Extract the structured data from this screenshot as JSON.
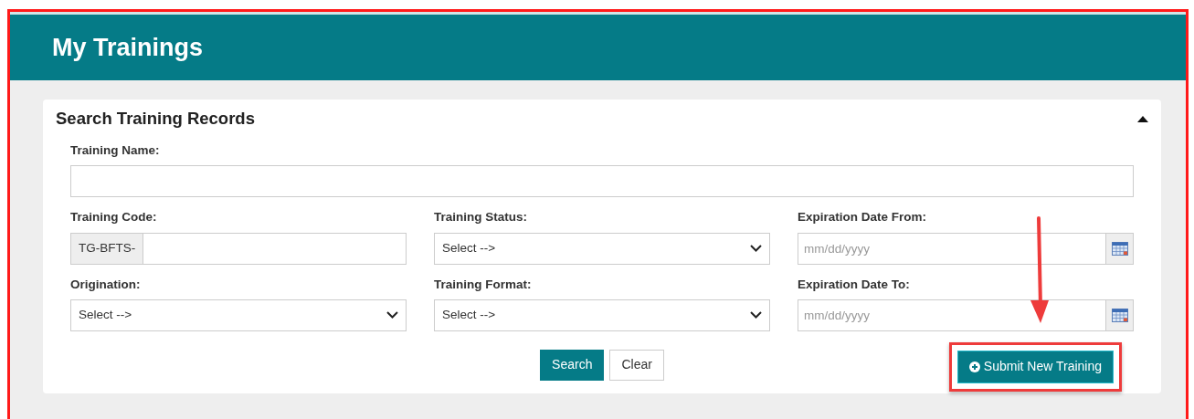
{
  "header": {
    "title": "My Trainings"
  },
  "panel": {
    "title": "Search Training Records",
    "expanded": true
  },
  "name_field": {
    "label": "Training Name:"
  },
  "fields": [
    {
      "kind": "prefixed",
      "label": "Training Code:",
      "prefix": "TG-BFTS-"
    },
    {
      "kind": "select",
      "label": "Training Status:",
      "value": "Select -->"
    },
    {
      "kind": "date",
      "label": "Expiration Date From:",
      "placeholder": "mm/dd/yyyy"
    },
    {
      "kind": "select",
      "label": "Origination:",
      "value": "Select -->"
    },
    {
      "kind": "select",
      "label": "Training Format:",
      "value": "Select -->"
    },
    {
      "kind": "date",
      "label": "Expiration Date To:",
      "placeholder": "mm/dd/yyyy"
    }
  ],
  "buttons": [
    {
      "label": "Search",
      "primary": true
    },
    {
      "label": "Clear",
      "primary": false
    }
  ],
  "submit_button": {
    "label": "Submit New Training",
    "highlighted": true
  }
}
